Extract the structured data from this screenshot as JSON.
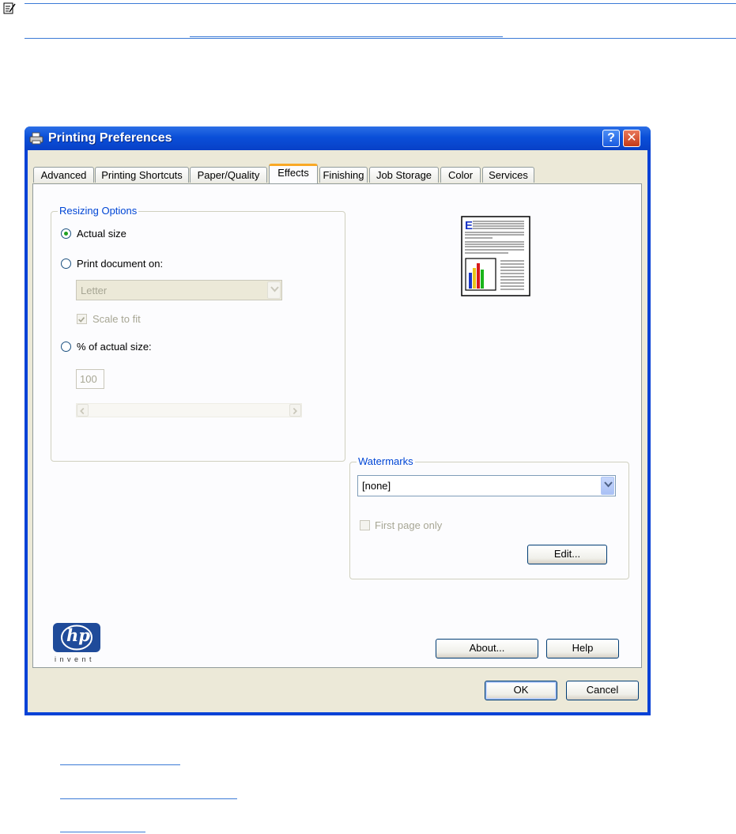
{
  "doc": {
    "note_icon": "note-icon"
  },
  "dialog": {
    "title": "Printing Preferences",
    "title_icon": "printer-icon",
    "help_glyph": "?",
    "close_glyph": "✕",
    "tabs": [
      {
        "label": "Advanced"
      },
      {
        "label": "Printing Shortcuts"
      },
      {
        "label": "Paper/Quality"
      },
      {
        "label": "Effects"
      },
      {
        "label": "Finishing"
      },
      {
        "label": "Job Storage"
      },
      {
        "label": "Color"
      },
      {
        "label": "Services"
      }
    ],
    "active_tab": "Effects",
    "resizing": {
      "legend": "Resizing Options",
      "actual_size": "Actual size",
      "print_document_on": "Print document on:",
      "paper_value": "Letter",
      "scale_to_fit": "Scale to fit",
      "percent_label": "% of actual size:",
      "percent_value": "100",
      "selected": "Actual size"
    },
    "watermarks": {
      "legend": "Watermarks",
      "value": "[none]",
      "first_page_only": "First page only",
      "edit_button": "Edit..."
    },
    "logo": {
      "hp_text": "hp",
      "invent_text": "i n v e n t"
    },
    "about_button": "About...",
    "help_button": "Help",
    "ok_button": "OK",
    "cancel_button": "Cancel"
  }
}
